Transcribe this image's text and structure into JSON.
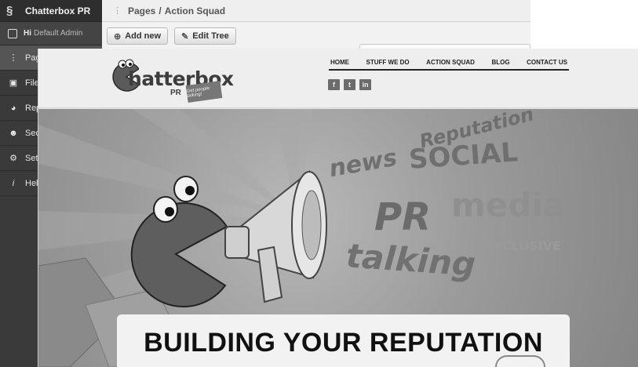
{
  "cms": {
    "brand": "Chatterbox PR",
    "user_greeting": "Hi",
    "user_name": "Default Admin",
    "nav": [
      {
        "label": "Pag",
        "icon": "sitemap-icon"
      },
      {
        "label": "File",
        "icon": "image-icon"
      },
      {
        "label": "Rep",
        "icon": "pie-chart-icon"
      },
      {
        "label": "Sec",
        "icon": "users-icon"
      },
      {
        "label": "Sett",
        "icon": "wrench-icon"
      },
      {
        "label": "Help",
        "icon": "info-icon"
      }
    ],
    "breadcrumb": {
      "section": "Pages",
      "separator": "/",
      "page": "Action Squad"
    },
    "toolbar": {
      "add_label": "Add new",
      "edit_label": "Edit Tree"
    }
  },
  "site": {
    "logo_text": "hatterbox",
    "logo_sub": "PR",
    "logo_tagline": "Get people talking!",
    "nav": [
      "HOME",
      "STUFF WE DO",
      "ACTION SQUAD",
      "BLOG",
      "CONTACT US"
    ],
    "social": [
      {
        "icon": "facebook-icon",
        "glyph": "f"
      },
      {
        "icon": "twitter-icon",
        "glyph": "t"
      },
      {
        "icon": "linkedin-icon",
        "glyph": "in"
      }
    ],
    "hero_words": {
      "reputation": "Reputation",
      "news": "news",
      "social": "SOCIAL",
      "media": "media",
      "pr": "PR",
      "exclusive": "EXCLUSIVE",
      "talking": "talking"
    },
    "banner_title": "BUILDING YOUR REPUTATION"
  }
}
